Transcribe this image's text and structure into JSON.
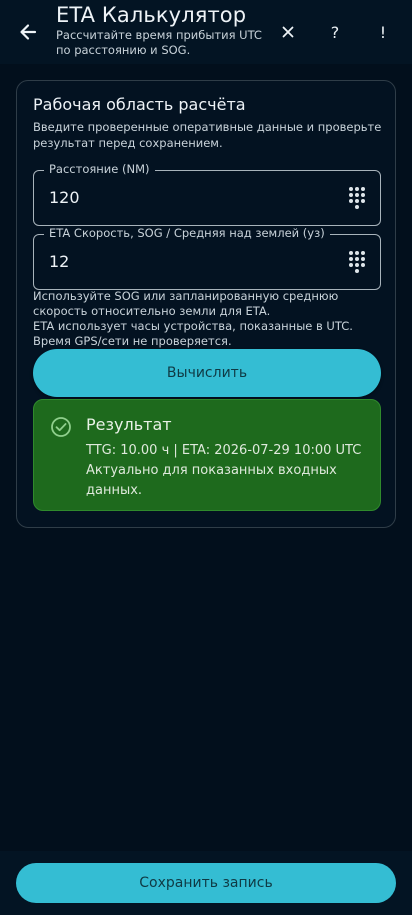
{
  "header": {
    "title": "ETA Калькулятор",
    "subtitle": "Рассчитайте время прибытия UTC по расстоянию и SOG.",
    "help_label": "?",
    "alert_label": "!"
  },
  "card": {
    "title": "Рабочая область расчёта",
    "description": "Введите проверенные оперативные данные и проверьте результат перед сохранением."
  },
  "fields": {
    "distance": {
      "label": "Расстояние (NM)",
      "value": "120"
    },
    "speed": {
      "label": "ETA Скорость, SOG / Средняя над землей (уз)",
      "value": "12"
    }
  },
  "hints": {
    "sog": "Используйте SOG или запланированную среднюю скорость относительно земли для ETA.",
    "utc": "ETA использует часы устройства, показанные в UTC. Время GPS/сети не проверяется."
  },
  "actions": {
    "calculate": "Вычислить",
    "save": "Сохранить запись"
  },
  "result": {
    "title": "Результат",
    "line1": "TTG: 10.00 ч | ETA: 2026-07-29 10:00 UTC",
    "line2": "Актуально для показанных входных",
    "line3": "данных."
  },
  "colors": {
    "background": "#020f1c",
    "accent": "#34bdd3",
    "result_bg": "#1e6a1d"
  },
  "icons": {
    "back": "arrow-left-icon",
    "close": "close-icon",
    "keypad": "keypad-icon",
    "result": "check-circle-icon"
  }
}
